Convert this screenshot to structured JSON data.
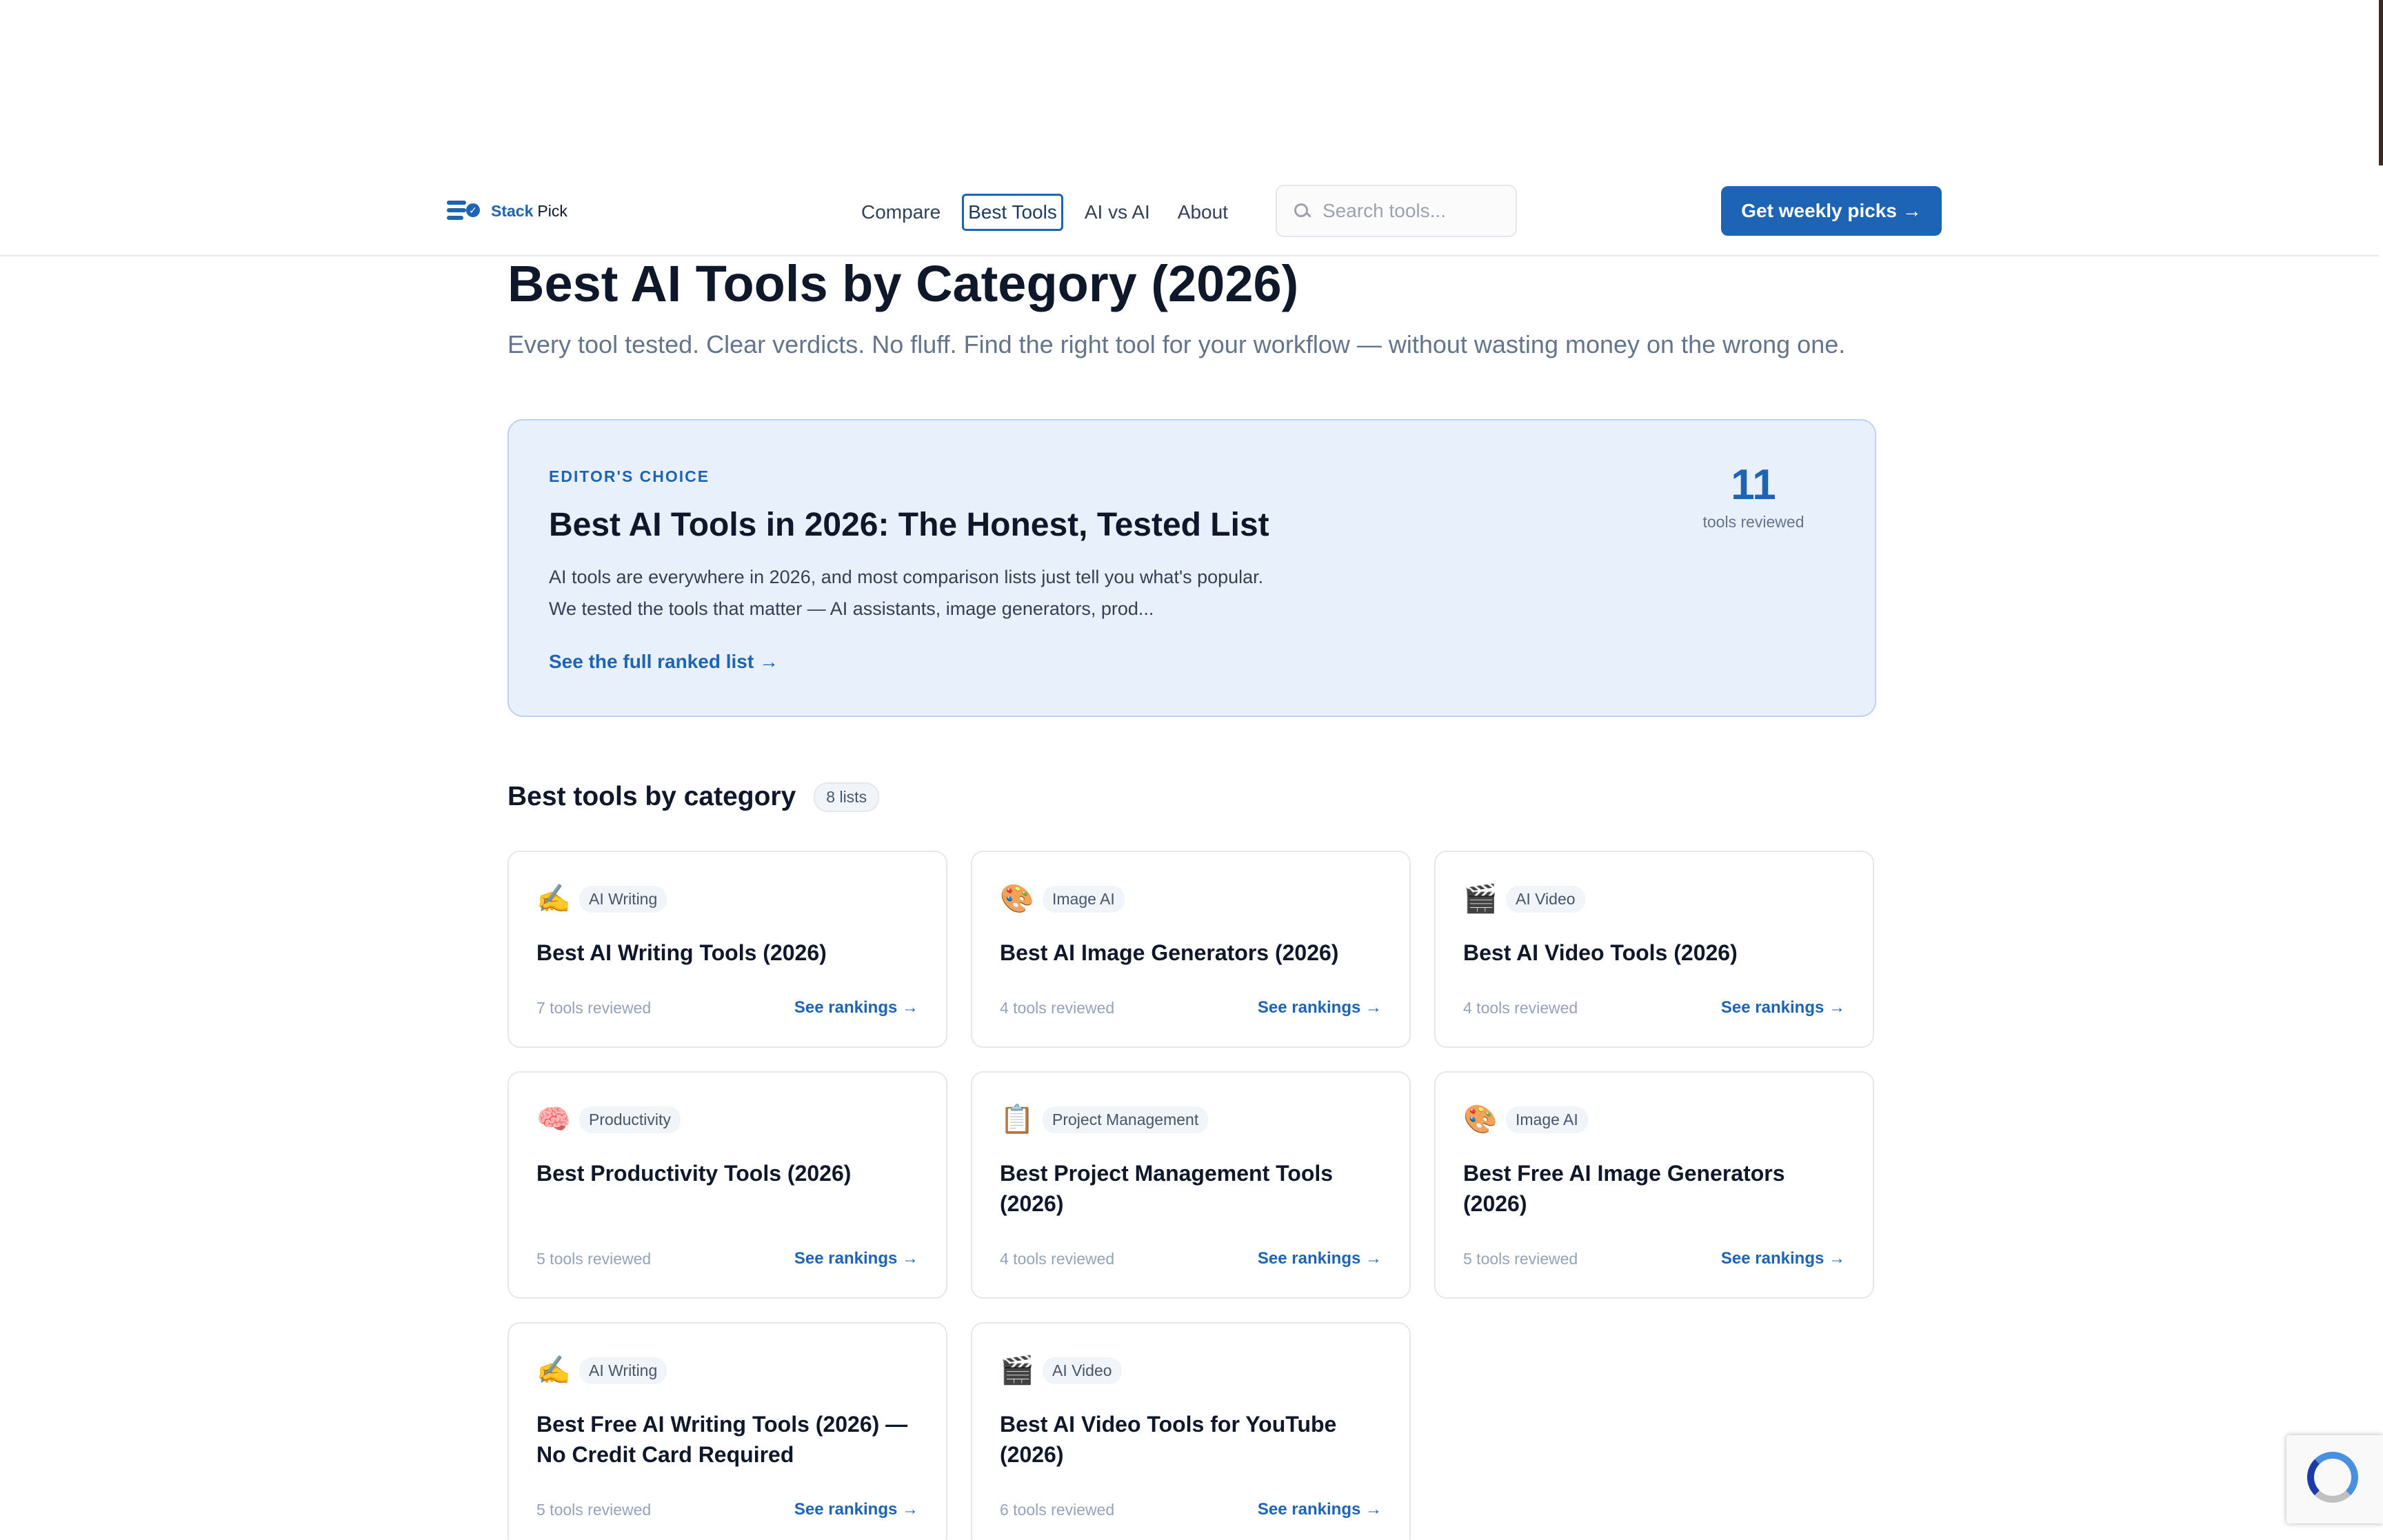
{
  "brand": {
    "name_primary": "Stack",
    "name_secondary": "Pick",
    "accent": "#1e64b4"
  },
  "nav": {
    "links": [
      {
        "label": "Compare",
        "active": false
      },
      {
        "label": "Best Tools",
        "active": true
      },
      {
        "label": "AI vs AI",
        "active": false
      },
      {
        "label": "About",
        "active": false
      }
    ],
    "search_placeholder": "Search tools...",
    "cta_label": "Get weekly picks →"
  },
  "page": {
    "title": "Best AI Tools by Category (2026)",
    "subtitle": "Every tool tested. Clear verdicts. No fluff. Find the right tool for your workflow — without wasting money on the wrong one."
  },
  "featured": {
    "eyebrow": "EDITOR'S CHOICE",
    "title": "Best AI Tools in 2026: The Honest, Tested List",
    "description_line1": "AI tools are everywhere in 2026, and most comparison lists just tell you what's popular.",
    "description_line2": "We tested the tools that matter — AI assistants, image generators, prod...",
    "link_label": "See the full ranked list →",
    "stat_number": "11",
    "stat_label": "tools reviewed"
  },
  "category_section": {
    "title": "Best tools by category",
    "count_label": "8 lists",
    "cards": [
      {
        "icon": "✍️",
        "icon_name": "writing-hand-icon",
        "tag": "AI Writing",
        "title": "Best AI Writing Tools (2026)",
        "meta": "7 tools reviewed",
        "link": "See rankings →"
      },
      {
        "icon": "🎨",
        "icon_name": "artist-palette-icon",
        "tag": "Image AI",
        "title": "Best AI Image Generators (2026)",
        "meta": "4 tools reviewed",
        "link": "See rankings →"
      },
      {
        "icon": "🎬",
        "icon_name": "clapper-board-icon",
        "tag": "AI Video",
        "title": "Best AI Video Tools (2026)",
        "meta": "4 tools reviewed",
        "link": "See rankings →"
      },
      {
        "icon": "🧠",
        "icon_name": "brain-icon",
        "tag": "Productivity",
        "title": "Best Productivity Tools (2026)",
        "meta": "5 tools reviewed",
        "link": "See rankings →"
      },
      {
        "icon": "📋",
        "icon_name": "clipboard-icon",
        "tag": "Project Management",
        "title": "Best Project Management Tools (2026)",
        "meta": "4 tools reviewed",
        "link": "See rankings →"
      },
      {
        "icon": "🎨",
        "icon_name": "artist-palette-icon",
        "tag": "Image AI",
        "title": "Best Free AI Image Generators (2026)",
        "meta": "5 tools reviewed",
        "link": "See rankings →"
      },
      {
        "icon": "✍️",
        "icon_name": "writing-hand-icon",
        "tag": "AI Writing",
        "title": "Best Free AI Writing Tools (2026) — No Credit Card Required",
        "meta": "5 tools reviewed",
        "link": "See rankings →"
      },
      {
        "icon": "🎬",
        "icon_name": "clapper-board-icon",
        "tag": "AI Video",
        "title": "Best AI Video Tools for YouTube (2026)",
        "meta": "6 tools reviewed",
        "link": "See rankings →"
      }
    ]
  }
}
